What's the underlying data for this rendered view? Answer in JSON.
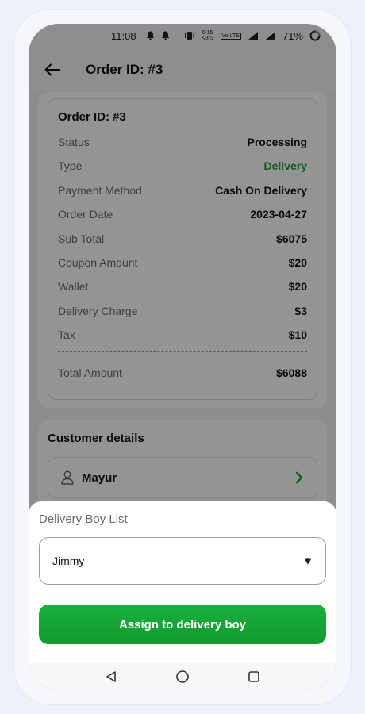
{
  "status_bar": {
    "time": "11:08",
    "battery": "71%",
    "data_speed_value": "0.15",
    "data_speed_unit": "KB/S",
    "volte": "Vo LTE"
  },
  "app_bar": {
    "title": "Order ID: #3"
  },
  "order": {
    "heading": "Order ID: #3",
    "rows": [
      {
        "label": "Status",
        "value": "Processing"
      },
      {
        "label": "Type",
        "value": "Delivery"
      },
      {
        "label": "Payment Method",
        "value": "Cash On Delivery"
      },
      {
        "label": "Order Date",
        "value": "2023-04-27"
      },
      {
        "label": "Sub Total",
        "value": "$6075"
      },
      {
        "label": "Coupon Amount",
        "value": "$20"
      },
      {
        "label": "Wallet",
        "value": "$20"
      },
      {
        "label": "Delivery Charge",
        "value": "$3"
      },
      {
        "label": "Tax",
        "value": "$10"
      }
    ],
    "total_label": "Total Amount",
    "total_value": "$6088"
  },
  "customer": {
    "title": "Customer details",
    "name": "Mayur"
  },
  "sheet": {
    "title": "Delivery Boy List",
    "selected": "Jimmy",
    "assign_label": "Assign to delivery boy"
  },
  "icons": {
    "back": "arrow-left-icon",
    "person": "person-icon",
    "chevron": "chevron-right-icon",
    "dropdown": "caret-down-icon"
  },
  "colors": {
    "accent": "#18b13c",
    "delivery_text": "#22a33a"
  }
}
